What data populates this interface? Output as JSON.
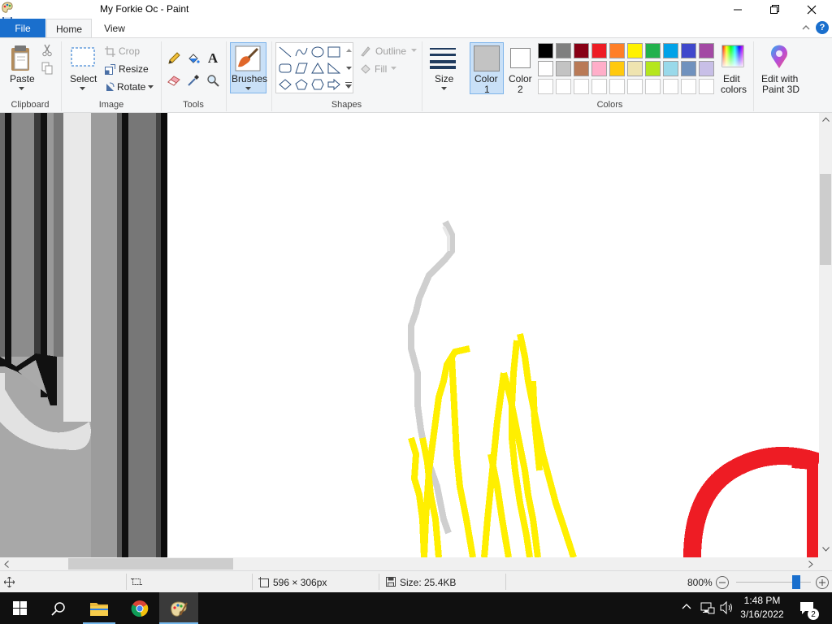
{
  "window": {
    "title": "My Forkie Oc - Paint",
    "controls": {
      "minimize": "─",
      "maximize": "❐",
      "close": "✕"
    }
  },
  "tabs": {
    "file": "File",
    "home": "Home",
    "view": "View"
  },
  "ribbon": {
    "clipboard": {
      "paste": "Paste",
      "group": "Clipboard"
    },
    "image": {
      "select": "Select",
      "crop": "Crop",
      "resize": "Resize",
      "rotate": "Rotate",
      "group": "Image"
    },
    "tools": {
      "group": "Tools"
    },
    "brushes": {
      "label": "Brushes"
    },
    "shapes": {
      "outline": "Outline",
      "fill": "Fill",
      "group": "Shapes"
    },
    "size": {
      "label": "Size"
    },
    "color1": {
      "line1": "Color",
      "line2": "1",
      "value": "#c3c3c3"
    },
    "color2": {
      "line1": "Color",
      "line2": "2",
      "value": "#ffffff"
    },
    "colors": {
      "group": "Colors",
      "row1": [
        "#000000",
        "#7f7f7f",
        "#880015",
        "#ed1c24",
        "#ff7f27",
        "#fff200",
        "#22b14c",
        "#00a2e8",
        "#3f48cc",
        "#a349a4"
      ],
      "row2": [
        "#ffffff",
        "#c3c3c3",
        "#b97a57",
        "#ffaec9",
        "#ffc90e",
        "#efe4b0",
        "#b5e61d",
        "#99d9ea",
        "#7092be",
        "#c8bfe7"
      ],
      "row3_count": 10
    },
    "edit_colors": {
      "line1": "Edit",
      "line2": "colors"
    },
    "paint3d": {
      "line1": "Edit with",
      "line2": "Paint 3D"
    }
  },
  "status": {
    "dimensions": "596 × 306px",
    "size": "Size: 25.4KB",
    "zoom": "800%",
    "zoom_level": 0.8
  },
  "taskbar": {
    "time": "1:48 PM",
    "date": "3/16/2022",
    "notifications": "2"
  }
}
